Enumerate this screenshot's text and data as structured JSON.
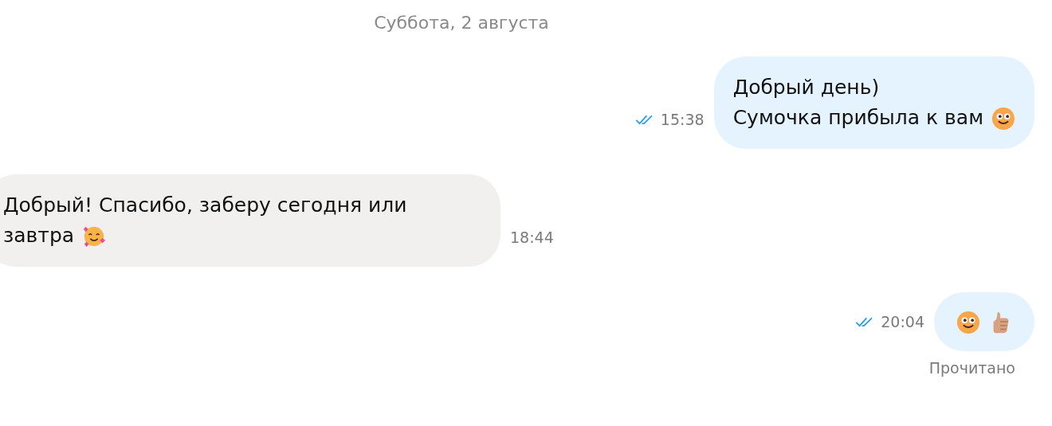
{
  "date_divider": "Суббота, 2 августа",
  "messages": [
    {
      "outgoing": true,
      "lines": [
        "Добрый день)",
        "Сумочка прибыла к вам"
      ],
      "emojis": [
        {
          "kind": "smile"
        }
      ],
      "time": "15:38",
      "read": true
    },
    {
      "outgoing": false,
      "lines": [
        "Добрый! Спасибо, заберу сегодня или завтра"
      ],
      "emojis": [
        {
          "kind": "hearts"
        }
      ],
      "time": "18:44"
    },
    {
      "outgoing": true,
      "emojis": [
        {
          "kind": "smile"
        },
        {
          "kind": "thumbs-up"
        }
      ],
      "time": "20:04",
      "read": true,
      "status": "Прочитано"
    }
  ]
}
